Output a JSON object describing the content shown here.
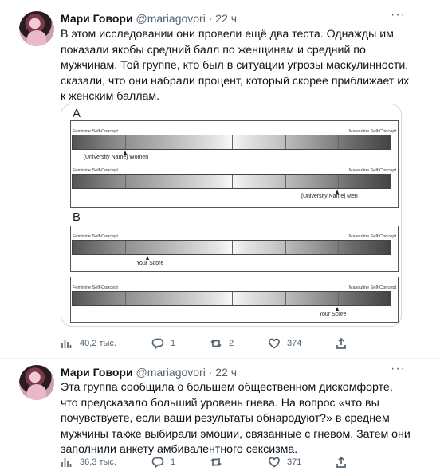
{
  "tweets": [
    {
      "author": "Мари Говори",
      "handle": "@mariagovori",
      "dot": "·",
      "time": "22 ч",
      "more": "···",
      "text": "В этом исследовании они провели ещё два теста. Однажды им показали якобы средний балл по женщинам и средний по мужчинам. Той группе, кто был в ситуации угрозы маскулинности, сказали, что они набрали процент, который скорее приближает их к женским баллам.",
      "figure": {
        "label_a": "A",
        "label_b": "B",
        "feminine_label": "Feminine Self-Concept",
        "masculine_label": "Masculine Self-Concept",
        "rows": [
          {
            "marker_label": "[University Name] Women",
            "marker_position": 0.17
          },
          {
            "marker_label": "[University Name] Men",
            "marker_position": 0.83
          },
          {
            "marker_label": "Your Score",
            "marker_position": 0.24
          },
          {
            "marker_label": "Your Score",
            "marker_position": 0.83
          }
        ]
      },
      "stats": {
        "views": "40,2 тыс.",
        "replies": "1",
        "retweets": "2",
        "likes": "374"
      }
    },
    {
      "author": "Мари Говори",
      "handle": "@mariagovori",
      "dot": "·",
      "time": "22 ч",
      "more": "···",
      "text": "Эта группа сообщила о большем общественном дискомфорте, что предсказало больший уровень гнева. На вопрос «что вы почувствуете, если ваши результаты обнародуют?» в среднем мужчины также выбирали эмоции, связанные с гневом. Затем они заполнили анкету амбивалентного сексизма.",
      "stats": {
        "views": "36,3 тыс.",
        "replies": "1",
        "retweets": "",
        "likes": "371"
      }
    }
  ]
}
